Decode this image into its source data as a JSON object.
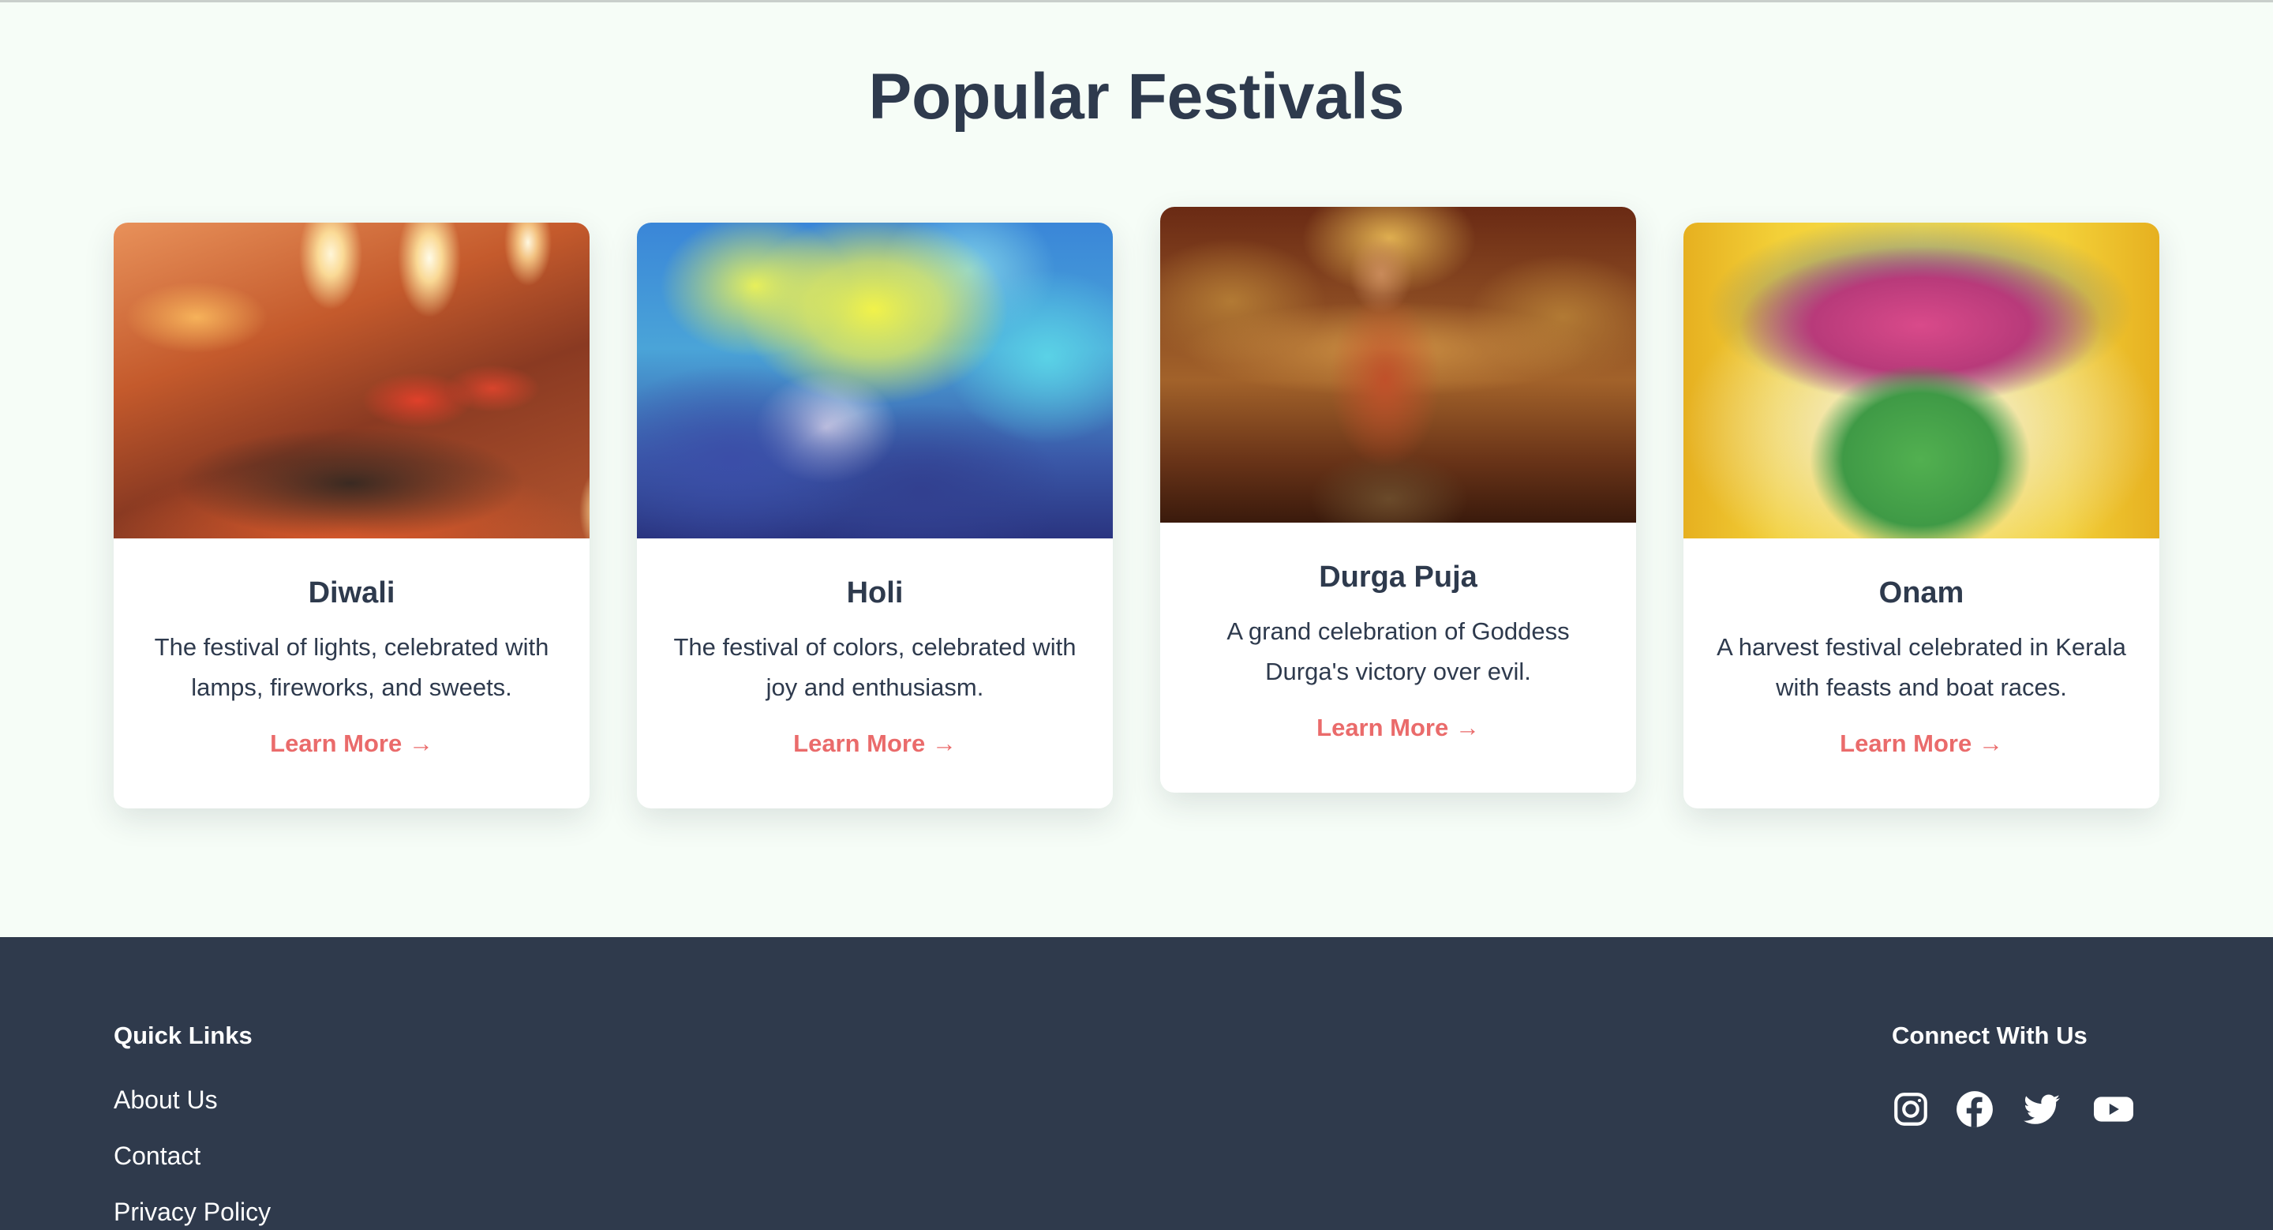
{
  "section": {
    "title": "Popular Festivals"
  },
  "festivals": [
    {
      "name": "Diwali",
      "description": "The festival of lights, celebrated with lamps, fireworks, and sweets.",
      "link": "Learn More →",
      "image": "diwali-lamps-photo"
    },
    {
      "name": "Holi",
      "description": "The festival of colors, celebrated with joy and enthusiasm.",
      "link": "Learn More →",
      "image": "holi-colors-photo"
    },
    {
      "name": "Durga Puja",
      "description": "A grand celebration of Goddess Durga's victory over evil.",
      "link": "Learn More →",
      "image": "durga-idol-photo"
    },
    {
      "name": "Onam",
      "description": "A harvest festival celebrated in Kerala with feasts and boat races.",
      "link": "Learn More →",
      "image": "onam-rangoli-photo"
    }
  ],
  "footer": {
    "quick_links": {
      "heading": "Quick Links",
      "items": [
        "About Us",
        "Contact",
        "Privacy Policy"
      ]
    },
    "connect": {
      "heading": "Connect With Us",
      "icons": [
        "instagram-icon",
        "facebook-icon",
        "twitter-icon",
        "youtube-icon"
      ]
    }
  },
  "colors": {
    "accent": "#ea6b6b",
    "text": "#2e3a4d",
    "background": "#f6fdf7",
    "footer": "#2f3a4c"
  }
}
